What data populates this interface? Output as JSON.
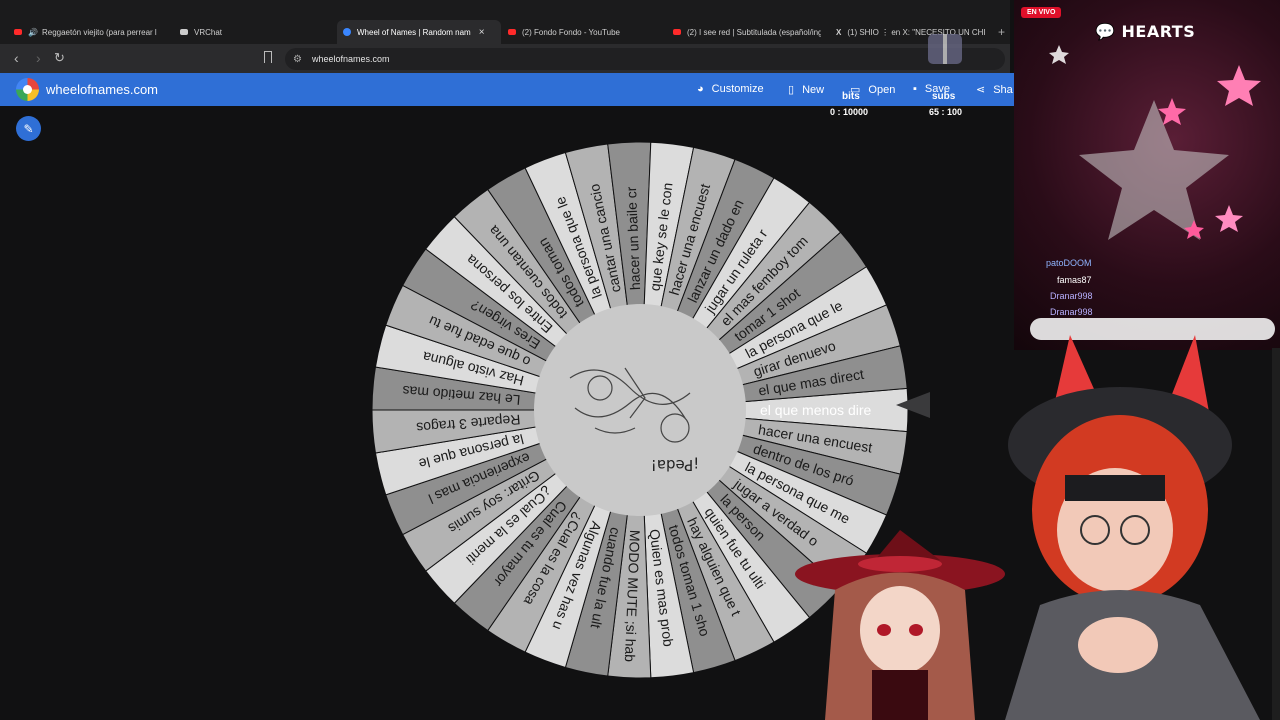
{
  "browser": {
    "tabs": [
      {
        "title": "Reggaetón viejito (para perrear l",
        "icon_color": "#ff2a2a",
        "has_audio": true
      },
      {
        "title": "VRChat",
        "icon_color": "#cccccc"
      },
      {
        "title": "Wheel of Names | Random nam",
        "icon_color": "#3a86ff",
        "active": true
      },
      {
        "title": "(2) Fondo Fondo - YouTube",
        "icon_color": "#ff2a2a"
      },
      {
        "title": "(2) I see red | Subtitulada (español/ing",
        "icon_color": "#ff2a2a"
      },
      {
        "title": "(1) SHIO ⋮ en X: \"NECESITO UN CHI",
        "icon_color": "#ffffff"
      }
    ],
    "url": "wheelofnames.com",
    "icons": {
      "back": "arrow-left-icon",
      "forward": "arrow-right-icon",
      "reload": "reload-icon",
      "bookmark": "bookmark-icon"
    }
  },
  "site": {
    "name": "wheelofnames.com",
    "brand_color": "#2f6fd6",
    "menu": {
      "customize": "Customize",
      "new": "New",
      "open": "Open",
      "save": "Save",
      "share": "Sha"
    }
  },
  "overlay": {
    "bits_label": "bits",
    "subs_label": "subs",
    "bits_count": "0 : 10000",
    "subs_count": "65 : 100",
    "live_label": "EN VIVO",
    "hearts_title": "HEARTS",
    "chat": [
      {
        "user": "patoDOOM",
        "color": "#8fb4ff"
      },
      {
        "user": "famas87",
        "color": "#ffffff"
      },
      {
        "user": "Dranar998",
        "color": "#b8b0ff"
      },
      {
        "user": "Dranar998",
        "color": "#b8b0ff"
      }
    ]
  },
  "wheel": {
    "pointed_entry": "el que menos dire",
    "center_text": "¡Peda!",
    "colors": [
      "#dcdcdc",
      "#b3b3b3",
      "#8f8f8f"
    ],
    "entries": [
      "el que menos dire",
      "hacer una encuest",
      "dentro de los pró",
      "la persona que me",
      "jugar a verdad o",
      "la person",
      "quien fue tu ulti",
      "hay alguien que t",
      "todos toman 1 sho",
      "Quien es mas prob",
      "MODO MUTE ;si hab",
      "cuando fue la ult",
      "Algunas vez has u",
      "¿Cual es la cosa",
      "Cual es tu mayor",
      "¿Cual es la menti",
      "Gritar: soy sumis",
      "experiencia mas l",
      "la persona que le",
      "Reparte 3 tragos",
      "Le haz metido mas",
      "Haz visto alguna",
      "o que edad fue tu",
      "Eres virgen?",
      "Entre los persona",
      "todos cuentan una",
      "todos toman",
      "la persona que le",
      "cantar una cancio",
      "hacer un baile cr",
      "que key se le con",
      "hacer una encuest",
      "lanzar un dado en",
      "jugar un ruleta r",
      "el mas femboy tom",
      "tomar 1 shot",
      "la persona que le",
      "girar denuevo",
      "el que mas direct"
    ]
  }
}
